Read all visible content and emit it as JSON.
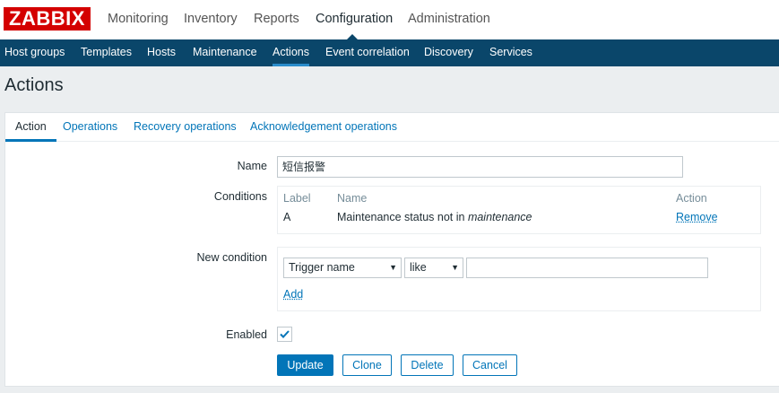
{
  "header": {
    "logo_text": "ZABBIX",
    "nav": [
      "Monitoring",
      "Inventory",
      "Reports",
      "Configuration",
      "Administration"
    ],
    "active_nav": "Configuration"
  },
  "subnav": {
    "items": [
      "Host groups",
      "Templates",
      "Hosts",
      "Maintenance",
      "Actions",
      "Event correlation",
      "Discovery",
      "Services"
    ],
    "active": "Actions"
  },
  "page": {
    "title": "Actions"
  },
  "tabs": {
    "items": [
      "Action",
      "Operations",
      "Recovery operations",
      "Acknowledgement operations"
    ],
    "active": "Action"
  },
  "form": {
    "name_label": "Name",
    "name_value": "短信报警",
    "conditions_label": "Conditions",
    "conditions": {
      "headers": {
        "label": "Label",
        "name": "Name",
        "action": "Action"
      },
      "rows": [
        {
          "label": "A",
          "name_prefix": "Maintenance status not in ",
          "name_value": "maintenance",
          "action": "Remove"
        }
      ]
    },
    "new_condition_label": "New condition",
    "new_condition": {
      "type_selected": "Trigger name",
      "operator_selected": "like",
      "value": "",
      "add_label": "Add"
    },
    "enabled_label": "Enabled",
    "enabled": true
  },
  "buttons": {
    "update": "Update",
    "clone": "Clone",
    "delete": "Delete",
    "cancel": "Cancel"
  },
  "colors": {
    "brand_red": "#d40000",
    "nav_blue": "#0a466a",
    "link_blue": "#0275b8"
  }
}
